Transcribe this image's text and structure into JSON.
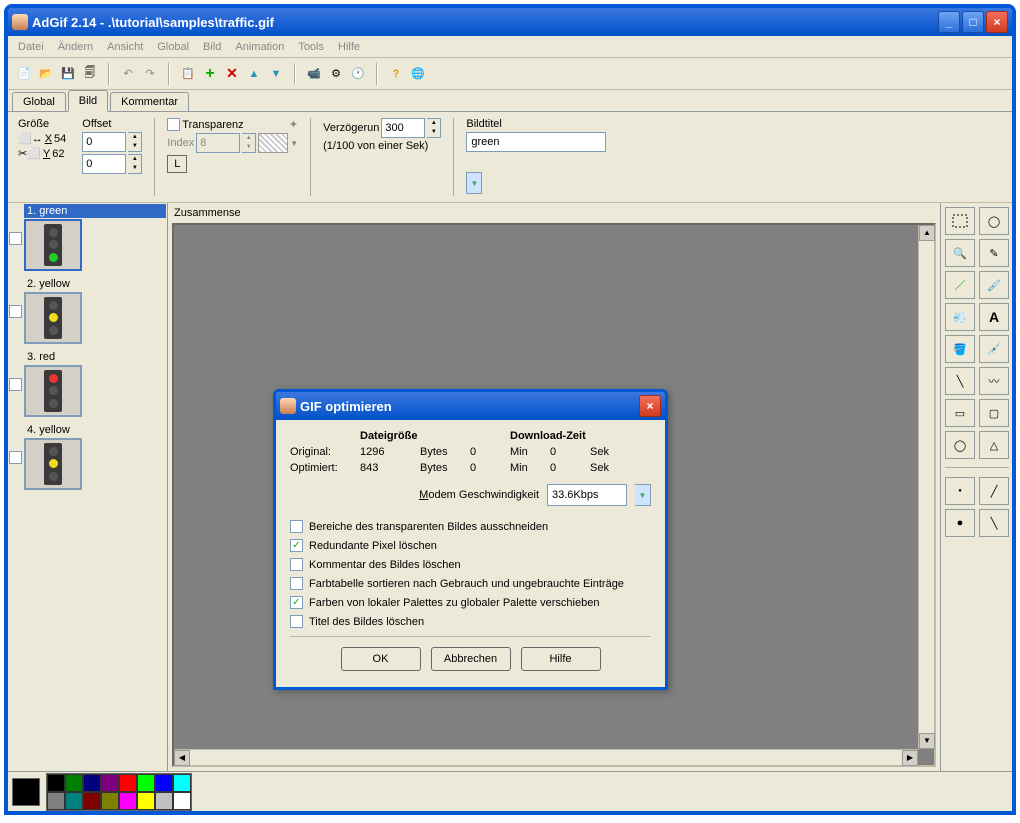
{
  "window": {
    "title": "AdGif 2.14 - .\\tutorial\\samples\\traffic.gif"
  },
  "menu": [
    "Datei",
    "Ändern",
    "Ansicht",
    "Global",
    "Bild",
    "Animation",
    "Tools",
    "Hilfe"
  ],
  "tabs": {
    "items": [
      "Global",
      "Bild",
      "Kommentar"
    ],
    "active": 1
  },
  "props": {
    "groesse_label": "Größe",
    "offset_label": "Offset",
    "x_label": "X",
    "y_label": "Y",
    "x_value": "54",
    "y_value": "62",
    "offset_x": "0",
    "offset_y": "0",
    "transparenz_label": "Transparenz",
    "index_label": "Index",
    "index_value": "8",
    "verzoegerung_label": "Verzögerun",
    "verzoegerung_value": "300",
    "verzoegerung_sub": "(1/100 von einer Sek)",
    "bildtitel_label": "Bildtitel",
    "bildtitel_value": "green",
    "zusammen_label": "Zusammense"
  },
  "frames": [
    {
      "label": "1. green",
      "selected": true,
      "lit": "green",
      "checked": false
    },
    {
      "label": "2. yellow",
      "selected": false,
      "lit": "yellow",
      "checked": false
    },
    {
      "label": "3. red",
      "selected": false,
      "lit": "red",
      "checked": false
    },
    {
      "label": "4. yellow",
      "selected": false,
      "lit": "yellow",
      "checked": false
    }
  ],
  "dialog": {
    "title": "GIF optimieren",
    "col_size": "Dateigröße",
    "col_time": "Download-Zeit",
    "row_original": "Original:",
    "row_optimiert": "Optimiert:",
    "bytes": "Bytes",
    "min": "Min",
    "sek": "Sek",
    "orig_size": "1296",
    "opt_size": "843",
    "orig_min": "0",
    "orig_sek": "0",
    "opt_min": "0",
    "opt_sek": "0",
    "modem_label": "Modem Geschwindigkeit",
    "modem_value": "33.6Kbps",
    "options": [
      {
        "label": "Bereiche des transparenten Bildes ausschneiden",
        "checked": false
      },
      {
        "label": "Redundante Pixel löschen",
        "checked": true
      },
      {
        "label": "Kommentar des Bildes löschen",
        "checked": false
      },
      {
        "label": "Farbtabelle sortieren nach Gebrauch und ungebrauchte Einträge",
        "checked": false
      },
      {
        "label": "Farben von lokaler Palettes zu globaler Palette verschieben",
        "checked": true
      },
      {
        "label": "Titel des Bildes löschen",
        "checked": false
      }
    ],
    "btn_ok": "OK",
    "btn_cancel": "Abbrechen",
    "btn_help": "Hilfe"
  },
  "palette": [
    "#000000",
    "#008000",
    "#000080",
    "#800080",
    "#ff0000",
    "#00ff00",
    "#0000ff",
    "#00ffff",
    "#808080",
    "#008080",
    "#800000",
    "#808000",
    "#ff00ff",
    "#ffff00",
    "#c0c0c0",
    "#ffffff"
  ],
  "tool_icons": [
    "select-rect",
    "select-free",
    "zoom",
    "pencil",
    "line",
    "brush",
    "spray",
    "text",
    "bucket",
    "eyedropper",
    "line-tool",
    "curve",
    "rect",
    "rounded-rect",
    "ellipse",
    "polygon"
  ]
}
